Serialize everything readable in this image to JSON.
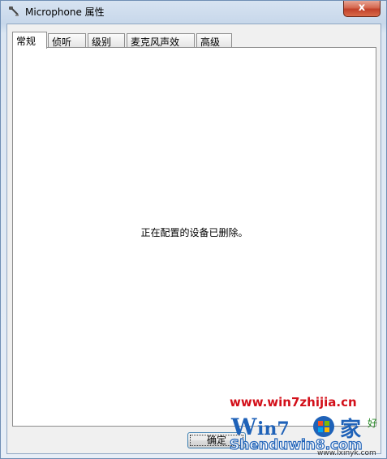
{
  "window": {
    "title": "Microphone 属性",
    "close_symbol": "x"
  },
  "tabs": [
    {
      "label": "常规",
      "active": true
    },
    {
      "label": "侦听",
      "active": false
    },
    {
      "label": "级别",
      "active": false
    },
    {
      "label": "麦克风声效",
      "active": false
    },
    {
      "label": "高级",
      "active": false
    }
  ],
  "panel": {
    "message": "正在配置的设备已删除。"
  },
  "buttons": {
    "ok_label": "确定"
  },
  "watermark": {
    "url": "www.win7zhijia.cn",
    "brand": "Shenduwin8.com",
    "sub": "www.lxinyk.com"
  },
  "colors": {
    "accent": "#3c7fb1",
    "close_red": "#c1412a",
    "watermark_red": "#d3101a",
    "watermark_blue": "#1f62b8"
  },
  "icons": {
    "title": "microphone-icon",
    "close": "close-icon"
  }
}
